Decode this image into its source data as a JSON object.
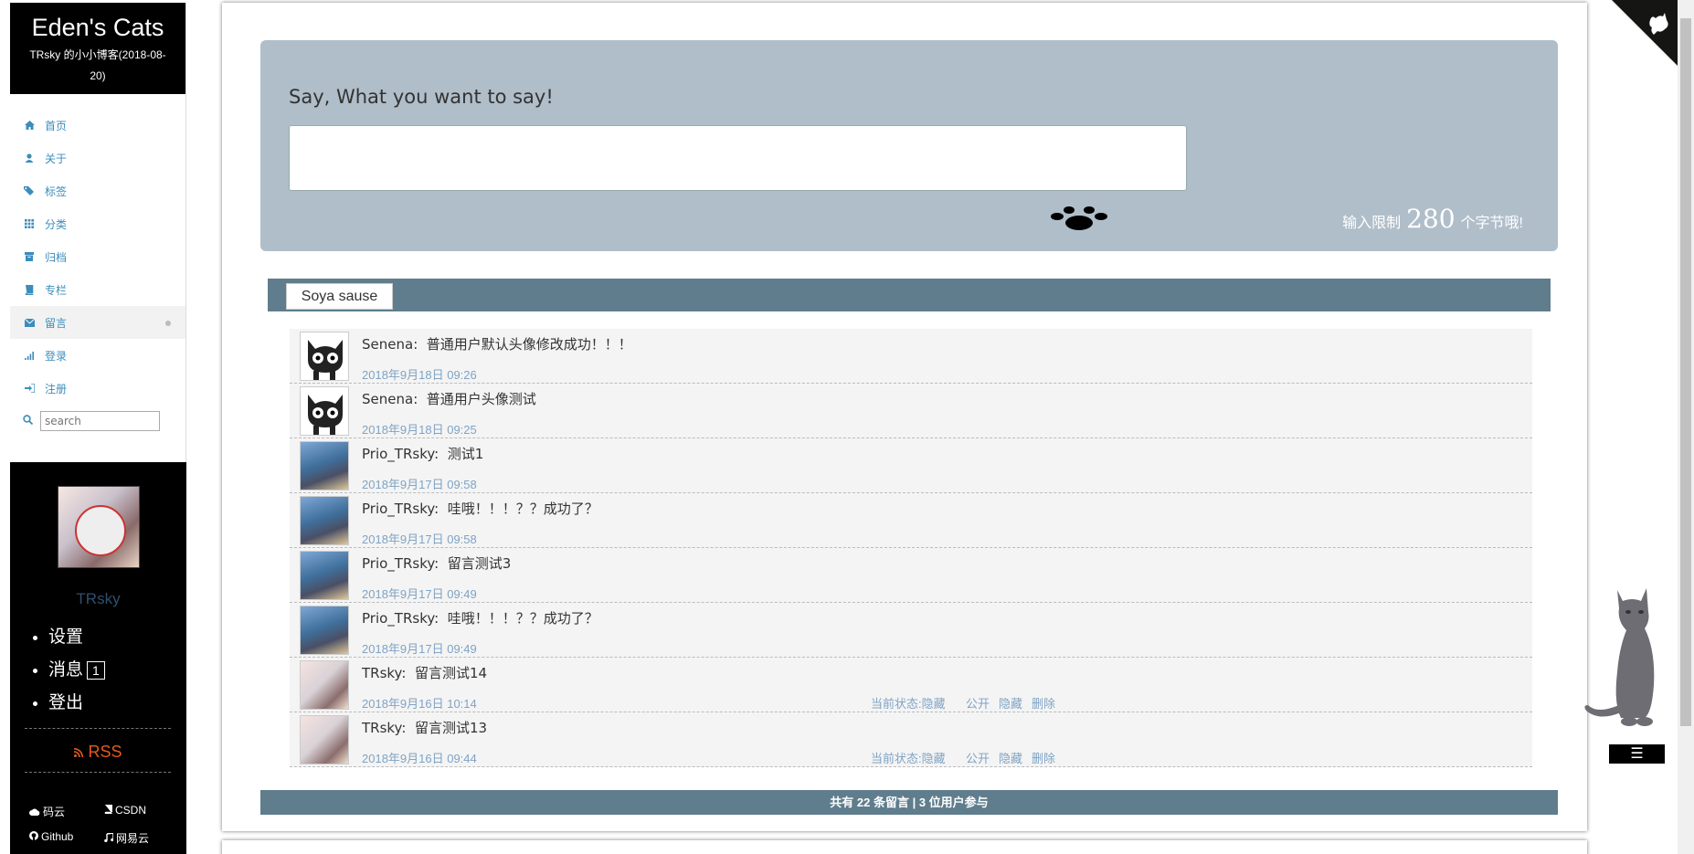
{
  "brand": {
    "title": "Eden's Cats",
    "subtitle": "TRsky 的小小博客(2018-08-20)"
  },
  "nav": [
    {
      "label": "首页",
      "icon": "home-icon"
    },
    {
      "label": "关于",
      "icon": "user-icon"
    },
    {
      "label": "标签",
      "icon": "tags-icon"
    },
    {
      "label": "分类",
      "icon": "grid-icon"
    },
    {
      "label": "归档",
      "icon": "archive-icon"
    },
    {
      "label": "专栏",
      "icon": "book-icon"
    },
    {
      "label": "留言",
      "icon": "envelope-icon"
    },
    {
      "label": "登录",
      "icon": "signal-icon"
    },
    {
      "label": "注册",
      "icon": "signin-icon"
    }
  ],
  "search": {
    "placeholder": "search"
  },
  "profile": {
    "username": "TRsky",
    "menu": [
      {
        "label": "设置"
      },
      {
        "label": "消息",
        "badge": "1"
      },
      {
        "label": "登出"
      }
    ],
    "rss": "RSS",
    "links": [
      {
        "label": "码云",
        "icon": "cloud-icon"
      },
      {
        "label": "CSDN",
        "icon": "book-icon"
      },
      {
        "label": "Github",
        "icon": "github-icon"
      },
      {
        "label": "网易云",
        "icon": "music-icon"
      }
    ]
  },
  "say": {
    "title": "Say, What you want to say!",
    "input_value": "",
    "limit_prefix": "输入限制",
    "limit_value": "280",
    "limit_suffix": "个字节哦!"
  },
  "tabs": [
    {
      "label": "Soya sause"
    }
  ],
  "comments": [
    {
      "author": "Senena",
      "text": "普通用户默认头像修改成功！！！",
      "date": "2018年9月18日 09:26",
      "avatar": "cat"
    },
    {
      "author": "Senena",
      "text": "普通用户头像测试",
      "date": "2018年9月18日 09:25",
      "avatar": "cat"
    },
    {
      "author": "Prio_TRsky",
      "text": "测试1",
      "date": "2018年9月17日 09:58",
      "avatar": "prio"
    },
    {
      "author": "Prio_TRsky",
      "text": "哇哦！！！？？成功了？",
      "date": "2018年9月17日 09:58",
      "avatar": "prio"
    },
    {
      "author": "Prio_TRsky",
      "text": "留言测试3",
      "date": "2018年9月17日 09:49",
      "avatar": "prio"
    },
    {
      "author": "Prio_TRsky",
      "text": "哇哦！！！？？成功了？",
      "date": "2018年9月17日 09:49",
      "avatar": "prio"
    },
    {
      "author": "TRsky",
      "text": "留言测试14",
      "date": "2018年9月16日 10:14",
      "avatar": "trsky",
      "state": "当前状态:隐藏",
      "actions": [
        "公开",
        "隐藏",
        "删除"
      ]
    },
    {
      "author": "TRsky",
      "text": "留言测试13",
      "date": "2018年9月16日 09:44",
      "avatar": "trsky",
      "state": "当前状态:隐藏",
      "actions": [
        "公开",
        "隐藏",
        "删除"
      ]
    }
  ],
  "footer": {
    "summary": "共有 22 条留言 | 3 位用户参与"
  },
  "menu_button": {
    "label": "☰"
  },
  "colors": {
    "accent": "#5f7d8c",
    "link": "#3c8dbc",
    "say_bg": "#b0bec9",
    "date": "#7fa3c4",
    "rss": "#e55a1a"
  }
}
